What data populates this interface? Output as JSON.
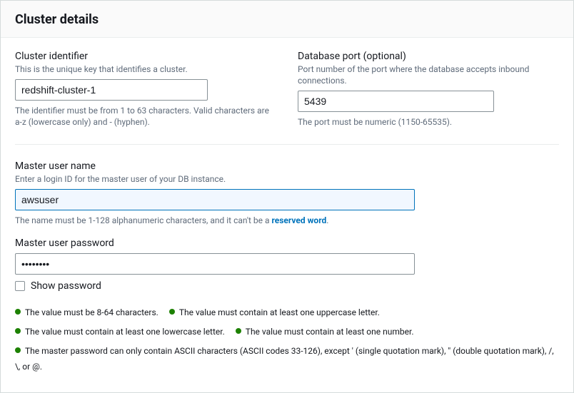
{
  "panel": {
    "title": "Cluster details"
  },
  "clusterId": {
    "label": "Cluster identifier",
    "desc": "This is the unique key that identifies a cluster.",
    "value": "redshift-cluster-1",
    "hint": "The identifier must be from 1 to 63 characters. Valid characters are a-z (lowercase only) and - (hyphen)."
  },
  "dbPort": {
    "label": "Database port (optional)",
    "desc": "Port number of the port where the database accepts inbound connections.",
    "value": "5439",
    "hint": "The port must be numeric (1150-65535)."
  },
  "masterUser": {
    "label": "Master user name",
    "desc": "Enter a login ID for the master user of your DB instance.",
    "value": "awsuser",
    "hintPrefix": "The name must be 1-128 alphanumeric characters, and it can't be a ",
    "hintLink": "reserved word",
    "hintSuffix": "."
  },
  "masterPassword": {
    "label": "Master user password",
    "value": "••••••••",
    "showLabel": "Show password"
  },
  "rules": {
    "r1": "The value must be 8-64 characters.",
    "r2": "The value must contain at least one uppercase letter.",
    "r3": "The value must contain at least one lowercase letter.",
    "r4": "The value must contain at least one number.",
    "r5": "The master password can only contain ASCII characters (ASCII codes 33-126), except ' (single quotation mark), \" (double quotation mark), /, \\, or @."
  }
}
